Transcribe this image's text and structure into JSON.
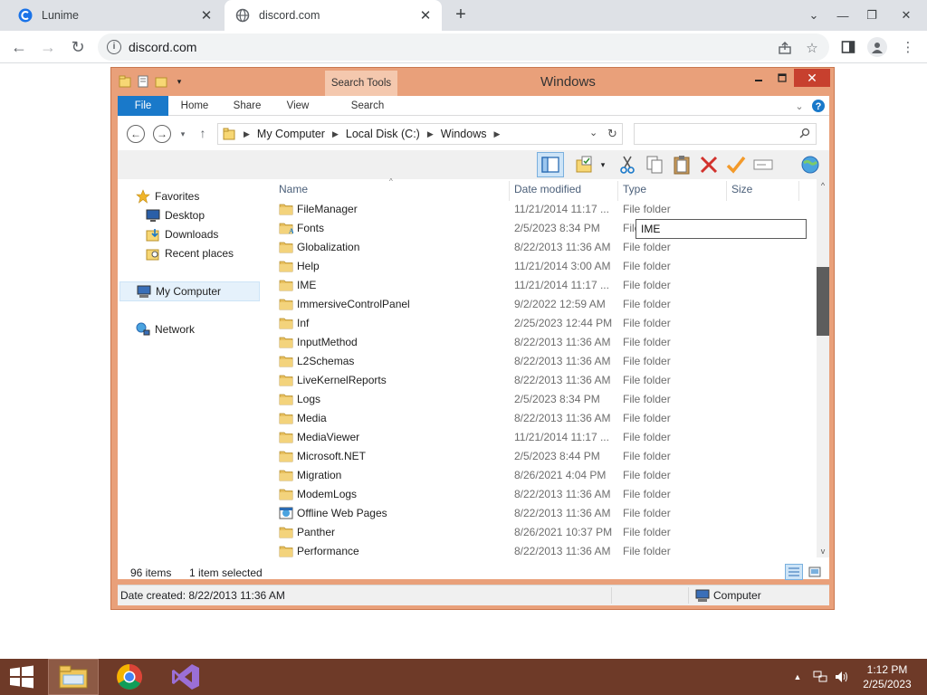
{
  "browser": {
    "tabs": [
      {
        "title": "Lunime",
        "close": "✕"
      },
      {
        "title": "discord.com",
        "close": "✕"
      }
    ],
    "new_tab": "+",
    "window_controls": {
      "collapse": "⌄",
      "minimize": "—",
      "restore": "❐",
      "close": "✕"
    },
    "url": "discord.com",
    "nav": {
      "back": "←",
      "forward": "→",
      "reload": "↻"
    }
  },
  "explorer": {
    "window_title": "Windows",
    "contextual_tab": "Search Tools",
    "ribbon_tabs": [
      "File",
      "Home",
      "Share",
      "View",
      "Search"
    ],
    "breadcrumbs": [
      "My Computer",
      "Local Disk (C:)",
      "Windows"
    ],
    "search_value": "",
    "nav_pane": {
      "favorites": "Favorites",
      "favorites_items": [
        "Desktop",
        "Downloads",
        "Recent places"
      ],
      "computer": "My Computer",
      "network": "Network"
    },
    "columns": {
      "name": "Name",
      "date": "Date modified",
      "type": "Type",
      "size": "Size"
    },
    "files": [
      {
        "name": "FileManager",
        "date": "11/21/2014 11:17 ...",
        "type": "File folder",
        "icon": "folder-icon"
      },
      {
        "name": "Fonts",
        "date": "2/5/2023 8:34 PM",
        "type": "File",
        "icon": "fonts-folder-icon"
      },
      {
        "name": "Globalization",
        "date": "8/22/2013 11:36 AM",
        "type": "File folder",
        "icon": "folder-icon"
      },
      {
        "name": "Help",
        "date": "11/21/2014 3:00 AM",
        "type": "File folder",
        "icon": "folder-icon"
      },
      {
        "name": "IME",
        "date": "11/21/2014 11:17 ...",
        "type": "File folder",
        "icon": "folder-icon"
      },
      {
        "name": "ImmersiveControlPanel",
        "date": "9/2/2022 12:59 AM",
        "type": "File folder",
        "icon": "folder-icon"
      },
      {
        "name": "Inf",
        "date": "2/25/2023 12:44 PM",
        "type": "File folder",
        "icon": "folder-icon"
      },
      {
        "name": "InputMethod",
        "date": "8/22/2013 11:36 AM",
        "type": "File folder",
        "icon": "folder-icon"
      },
      {
        "name": "L2Schemas",
        "date": "8/22/2013 11:36 AM",
        "type": "File folder",
        "icon": "folder-icon"
      },
      {
        "name": "LiveKernelReports",
        "date": "8/22/2013 11:36 AM",
        "type": "File folder",
        "icon": "folder-icon"
      },
      {
        "name": "Logs",
        "date": "2/5/2023 8:34 PM",
        "type": "File folder",
        "icon": "folder-icon"
      },
      {
        "name": "Media",
        "date": "8/22/2013 11:36 AM",
        "type": "File folder",
        "icon": "folder-icon"
      },
      {
        "name": "MediaViewer",
        "date": "11/21/2014 11:17 ...",
        "type": "File folder",
        "icon": "folder-icon"
      },
      {
        "name": "Microsoft.NET",
        "date": "2/5/2023 8:44 PM",
        "type": "File folder",
        "icon": "folder-icon"
      },
      {
        "name": "Migration",
        "date": "8/26/2021 4:04 PM",
        "type": "File folder",
        "icon": "folder-icon"
      },
      {
        "name": "ModemLogs",
        "date": "8/22/2013 11:36 AM",
        "type": "File folder",
        "icon": "folder-icon"
      },
      {
        "name": "Offline Web Pages",
        "date": "8/22/2013 11:36 AM",
        "type": "File folder",
        "icon": "offline-pages-icon"
      },
      {
        "name": "Panther",
        "date": "8/26/2021 10:37 PM",
        "type": "File folder",
        "icon": "folder-icon"
      },
      {
        "name": "Performance",
        "date": "8/22/2013 11:36 AM",
        "type": "File folder",
        "icon": "folder-icon"
      }
    ],
    "rename_value": "IME",
    "item_count": "96 items",
    "selection": "1 item selected",
    "date_created": "Date created: 8/22/2013 11:36 AM",
    "status_location": "Computer"
  },
  "taskbar": {
    "time": "1:12 PM",
    "date": "2/25/2023"
  },
  "colors": {
    "window_frame": "#e9a07a",
    "file_tab": "#1979ca",
    "taskbar": "#6e3a28",
    "folder": "#e8c060"
  }
}
